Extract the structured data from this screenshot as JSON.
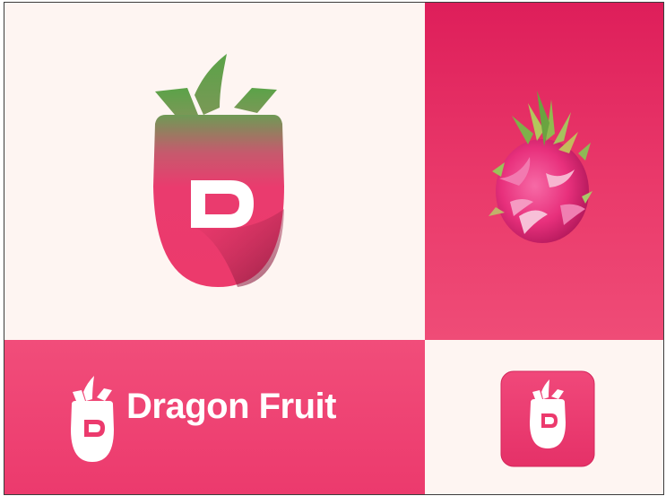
{
  "brand": {
    "name": "Dragon Fruit",
    "monogram": "D"
  },
  "colors": {
    "cream_background": "#fef5f2",
    "pink_primary": "#ec3a6d",
    "pink_deep": "#de1e5a",
    "leaf_green": "#5aa348",
    "white": "#ffffff"
  },
  "icons": [
    "dragon-fruit-logo-icon",
    "dragon-fruit-photo",
    "app-icon"
  ]
}
